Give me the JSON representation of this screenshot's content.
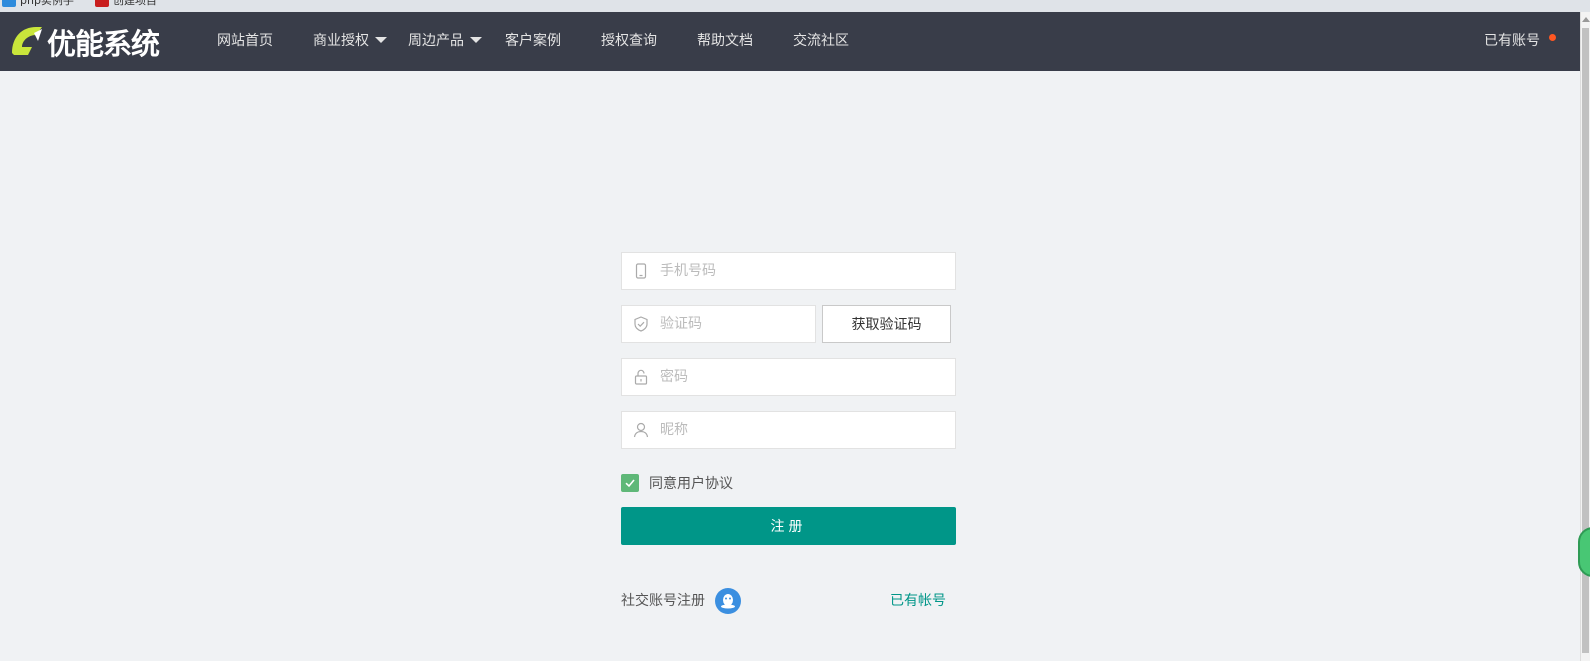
{
  "bookmarks": [
    {
      "label": "php实例手",
      "color": "#2e8bdc"
    },
    {
      "label": "创建项目",
      "color": "#c81e1e"
    }
  ],
  "nav": {
    "logo_text": "优能系统",
    "items": [
      {
        "label": "网站首页",
        "dropdown": false
      },
      {
        "label": "商业授权",
        "dropdown": true
      },
      {
        "label": "周边产品",
        "dropdown": true
      },
      {
        "label": "客户案例",
        "dropdown": false
      },
      {
        "label": "授权查询",
        "dropdown": false
      },
      {
        "label": "帮助文档",
        "dropdown": false
      },
      {
        "label": "交流社区",
        "dropdown": false
      }
    ],
    "account_label": "已有账号"
  },
  "form": {
    "phone_placeholder": "手机号码",
    "code_placeholder": "验证码",
    "get_code_label": "获取验证码",
    "password_placeholder": "密码",
    "nickname_placeholder": "昵称",
    "agree_label": "同意用户协议",
    "agree_checked": true,
    "submit_label": "注册",
    "social_label": "社交账号注册",
    "login_link": "已有帐号"
  },
  "colors": {
    "nav_bg": "#393d49",
    "primary": "#009688",
    "checkbox": "#5fb878",
    "notification": "#ff5722",
    "logo_accent": "#c9e63b"
  },
  "icons": {
    "phone": "phone-icon",
    "code": "shield-check-icon",
    "password": "lock-icon",
    "nickname": "user-icon",
    "social": "qq-icon"
  }
}
